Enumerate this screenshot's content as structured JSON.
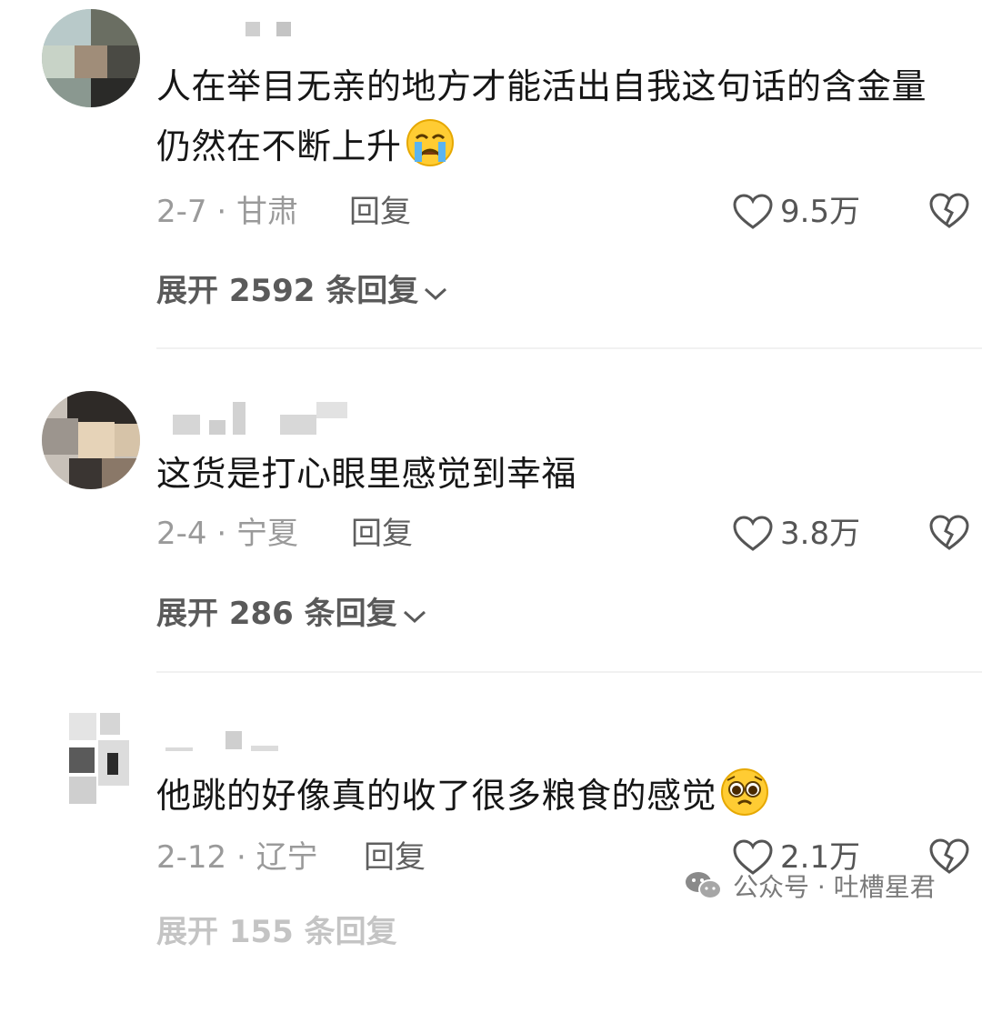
{
  "comments": [
    {
      "text": "人在举目无亲的地方才能活出自我这句话的含金量仍然在不断上升",
      "emoji": "crying-face",
      "date_location": "2-7 · 甘肃",
      "reply_label": "回复",
      "likes": "9.5万",
      "expand_label": "展开 2592 条回复"
    },
    {
      "text": "这货是打心眼里感觉到幸福",
      "date_location": "2-4 · 宁夏",
      "reply_label": "回复",
      "likes": "3.8万",
      "expand_label": "展开 286 条回复"
    },
    {
      "text": "他跳的好像真的收了很多粮食的感觉",
      "emoji": "pleading-face",
      "date_location": "2-12 · 辽宁",
      "reply_label": "回复",
      "likes": "2.1万",
      "expand_label": "展开 155 条回复"
    }
  ],
  "watermark": {
    "text": "公众号 · 吐槽星君"
  },
  "colors": {
    "secondary_text": "#9a9a9a",
    "icon": "#555555",
    "divider": "#f1f1f1"
  }
}
